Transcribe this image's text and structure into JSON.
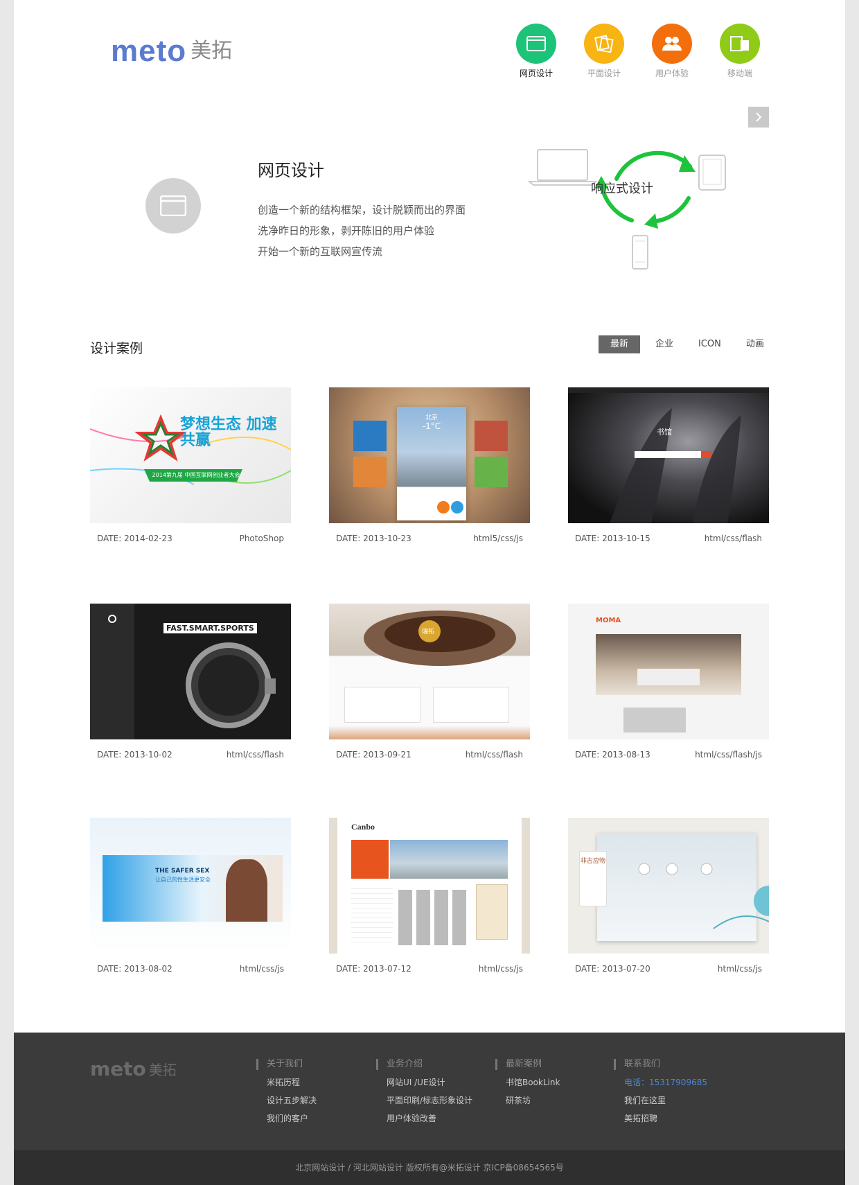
{
  "logo": {
    "latin": "meto",
    "cn": "美拓"
  },
  "nav": [
    {
      "label": "网页设计",
      "color": "#1ec37a",
      "icon": "browser-icon",
      "active": true
    },
    {
      "label": "平面设计",
      "color": "#f8b413",
      "icon": "papers-icon",
      "active": false
    },
    {
      "label": "用户体验",
      "color": "#f36f0c",
      "icon": "users-icon",
      "active": false
    },
    {
      "label": "移动端",
      "color": "#8fcb17",
      "icon": "devices-icon",
      "active": false
    }
  ],
  "hero": {
    "title": "网页设计",
    "lines": [
      "创造一个新的结构框架，设计脱颖而出的界面",
      "洗净昨日的形象，剥开陈旧的用户体验",
      "开始一个新的互联网宣传流"
    ],
    "responsive_label": "响应式设计",
    "accent": "#1ec33c"
  },
  "cases": {
    "title": "设计案例",
    "filters": [
      "最新",
      "企业",
      "ICON",
      "动画"
    ],
    "active_filter": "最新",
    "items": [
      {
        "date": "DATE: 2014-02-23",
        "tech": "PhotoShop",
        "thumb_text": "梦想生态 加速共赢",
        "thumb_sub": "2014第九届 中国互联网创业者大会"
      },
      {
        "date": "DATE: 2013-10-23",
        "tech": "html5/css/js",
        "thumb_text": "北京",
        "thumb_sub": "-1°C"
      },
      {
        "date": "DATE: 2013-10-15",
        "tech": "html/css/flash",
        "thumb_text": "书馆",
        "thumb_sub": ""
      },
      {
        "date": "DATE: 2013-10-02",
        "tech": "html/css/flash",
        "thumb_text": "FAST.SMART.SPORTS",
        "thumb_sub": ""
      },
      {
        "date": "DATE: 2013-09-21",
        "tech": "html/css/flash",
        "thumb_text": "瑞拓",
        "thumb_sub": ""
      },
      {
        "date": "DATE: 2013-08-13",
        "tech": "html/css/flash/js",
        "thumb_text": "MOMA",
        "thumb_sub": ""
      },
      {
        "date": "DATE: 2013-08-02",
        "tech": "html/css/js",
        "thumb_text": "THE SAFER SEX",
        "thumb_sub": "让自己的性生活更安全"
      },
      {
        "date": "DATE: 2013-07-12",
        "tech": "html/css/js",
        "thumb_text": "Canbo",
        "thumb_sub": ""
      },
      {
        "date": "DATE: 2013-07-20",
        "tech": "html/css/js",
        "thumb_text": "非古应物",
        "thumb_sub": ""
      }
    ]
  },
  "footer": {
    "logo": {
      "latin": "meto",
      "cn": "美拓"
    },
    "columns": [
      {
        "title": "关于我们",
        "links": [
          "米拓历程",
          "设计五步解决",
          "我们的客户"
        ]
      },
      {
        "title": "业务介绍",
        "links": [
          "网站UI /UE设计",
          "平面印刷/标志形象设计",
          "用户体验改善"
        ]
      },
      {
        "title": "最新案例",
        "links": [
          "书馆BookLink",
          "研茶坊"
        ]
      },
      {
        "title": "联系我们",
        "links": [
          "电话：15317909685",
          "我们在这里",
          "美拓招聘"
        ]
      }
    ],
    "copyright": "北京网站设计 / 河北网站设计 版权所有@米拓设计  京ICP备08654565号"
  }
}
